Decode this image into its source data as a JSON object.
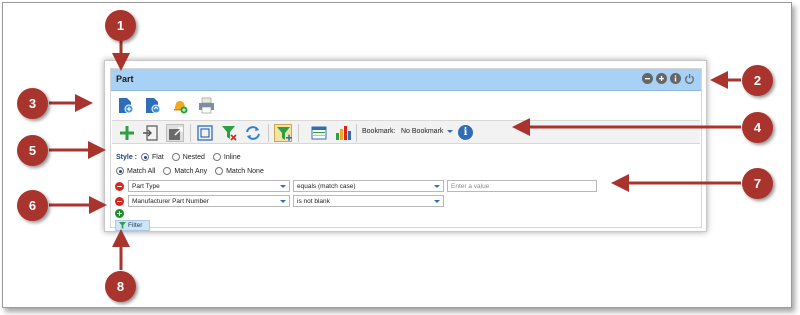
{
  "panel": {
    "title": "Part",
    "title_icons": [
      "zoom-out-icon",
      "zoom-in-icon",
      "info-icon",
      "power-icon"
    ]
  },
  "action_icons": [
    "new-document-icon",
    "open-document-icon",
    "alert-bell-icon",
    "print-icon"
  ],
  "toolbar": {
    "buttons": [
      "add-icon",
      "import-icon",
      "export-icon",
      "select-frame-icon",
      "clear-filter-icon",
      "refresh-icon",
      "add-filter-icon",
      "grid-view-icon",
      "bar-chart-icon"
    ],
    "bookmark_label": "Bookmark:",
    "bookmark_value": "No Bookmark"
  },
  "style": {
    "label": "Style :",
    "options": [
      "Flat",
      "Nested",
      "Inline"
    ],
    "selected": "Flat"
  },
  "match": {
    "options": [
      "Match All",
      "Match Any",
      "Match None"
    ],
    "selected": "Match All"
  },
  "conditions": [
    {
      "field": "Part Type",
      "operator": "equals (match case)",
      "value_placeholder": "Enter a value"
    },
    {
      "field": "Manufacturer Part Number",
      "operator": "is not blank"
    }
  ],
  "filter_button": "Filter",
  "callouts": [
    "1",
    "2",
    "3",
    "4",
    "5",
    "6",
    "7",
    "8"
  ],
  "colors": {
    "title_bar": "#a9d0f5",
    "callout": "#a8342d",
    "accent_blue": "#2f6db5",
    "remove_red": "#d9241c",
    "add_green": "#1f8a2c"
  }
}
